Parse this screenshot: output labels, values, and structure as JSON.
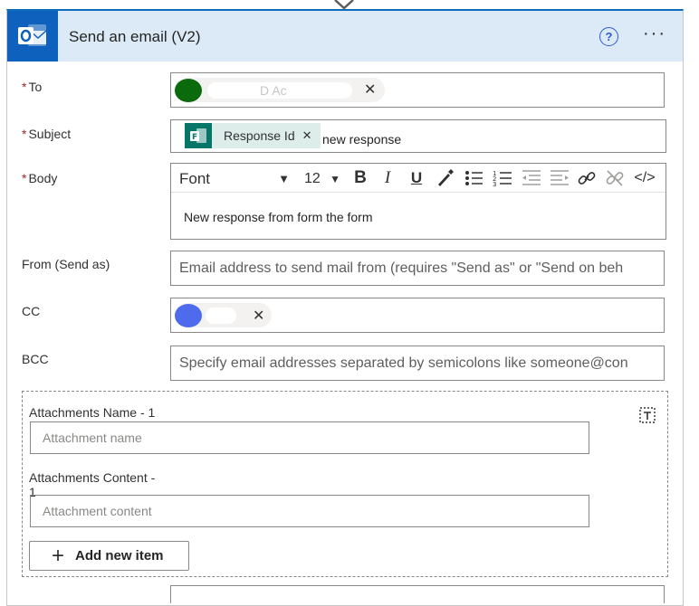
{
  "card": {
    "title": "Send an email (V2)",
    "help": "?",
    "more": "···"
  },
  "fields": {
    "to": {
      "label": "To",
      "chip_text": "D Ac"
    },
    "subject": {
      "label": "Subject",
      "token": "Response Id",
      "text": "new response"
    },
    "body": {
      "label": "Body",
      "font": "Font",
      "size": "12",
      "content": "New response from form the form"
    },
    "from": {
      "label": "From (Send as)",
      "placeholder": "Email address to send mail from (requires \"Send as\" or \"Send on beh"
    },
    "cc": {
      "label": "CC"
    },
    "bcc": {
      "label": "BCC",
      "placeholder": "Specify email addresses separated by semicolons like someone@con"
    }
  },
  "attachments": {
    "name_label": "Attachments Name - 1",
    "name_placeholder": "Attachment name",
    "content_label_line1": "Attachments Content -",
    "content_label_line2": "1",
    "content_placeholder": "Attachment content",
    "add_button": "Add new item"
  },
  "colors": {
    "accent": "#0e62bd",
    "header_bg": "#dbeaf6",
    "required": "#a4262c",
    "forms_green": "#077568"
  }
}
